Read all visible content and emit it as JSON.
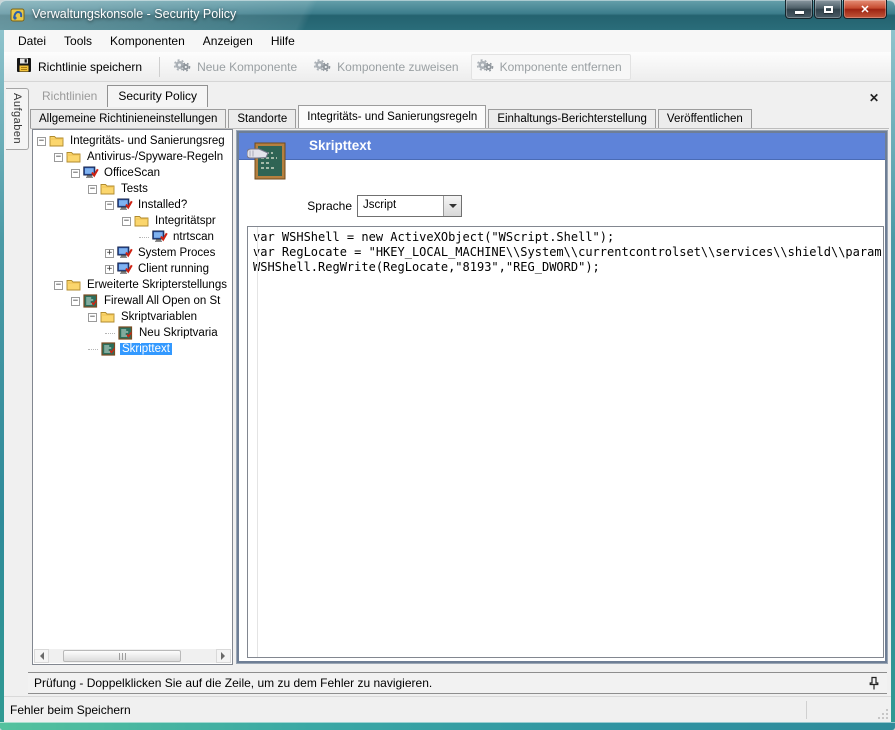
{
  "colors": {
    "titlebar_teal": "#24626f",
    "panel_header_blue": "#5e83d9",
    "tree_selection_blue": "#3399ff",
    "close_button_red": "#b03522"
  },
  "window": {
    "title": "Verwaltungskonsole - Security Policy",
    "controls": {
      "minimize": "minimize",
      "maximize": "maximize",
      "close": "close"
    }
  },
  "menu": {
    "items": [
      "Datei",
      "Tools",
      "Komponenten",
      "Anzeigen",
      "Hilfe"
    ]
  },
  "toolbar": {
    "save_label": "Richtlinie speichern",
    "new_component_label": "Neue Komponente",
    "assign_component_label": "Komponente zuweisen",
    "remove_component_label": "Komponente entfernen"
  },
  "side_tab": {
    "label": "Aufgaben"
  },
  "doc_tabs": [
    {
      "label": "Richtlinien",
      "active": false
    },
    {
      "label": "Security Policy",
      "active": true
    }
  ],
  "section_tabs": [
    {
      "label": "Allgemeine Richtinieneinstellungen",
      "active": false
    },
    {
      "label": "Standorte",
      "active": false
    },
    {
      "label": "Integritäts- und Sanierungsregeln",
      "active": true
    },
    {
      "label": "Einhaltungs-Berichterstellung",
      "active": false
    },
    {
      "label": "Veröffentlichen",
      "active": false
    }
  ],
  "tree": {
    "items": [
      {
        "label": "Integritäts- und Sanierungsreg",
        "level": 0,
        "expander": "-",
        "icon": "folder",
        "selected": false
      },
      {
        "label": "Antivirus-/Spyware-Regeln",
        "level": 1,
        "expander": "-",
        "icon": "folder",
        "selected": false
      },
      {
        "label": "OfficeScan",
        "level": 2,
        "expander": "-",
        "icon": "computer",
        "selected": false
      },
      {
        "label": "Tests",
        "level": 3,
        "expander": "-",
        "icon": "folder",
        "selected": false
      },
      {
        "label": "Installed?",
        "level": 4,
        "expander": "-",
        "icon": "computer",
        "selected": false
      },
      {
        "label": "Integritätspr",
        "level": 5,
        "expander": "-",
        "icon": "folder",
        "selected": false
      },
      {
        "label": "ntrtscan",
        "level": 6,
        "expander": null,
        "icon": "computer",
        "selected": false
      },
      {
        "label": "System Proces",
        "level": 4,
        "expander": "+",
        "icon": "computer",
        "selected": false
      },
      {
        "label": "Client running",
        "level": 4,
        "expander": "+",
        "icon": "computer",
        "selected": false
      },
      {
        "label": "Erweiterte Skripterstellungs",
        "level": 1,
        "expander": "-",
        "icon": "folder",
        "selected": false
      },
      {
        "label": "Firewall All Open on St",
        "level": 2,
        "expander": "-",
        "icon": "script",
        "selected": false
      },
      {
        "label": "Skriptvariablen",
        "level": 3,
        "expander": "-",
        "icon": "folder",
        "selected": false
      },
      {
        "label": "Neu Skriptvaria",
        "level": 4,
        "expander": null,
        "icon": "script",
        "selected": false
      },
      {
        "label": "Skripttext",
        "level": 3,
        "expander": null,
        "icon": "script",
        "selected": true
      }
    ]
  },
  "panel": {
    "title": "Skripttext",
    "language_label": "Sprache",
    "language_value": "Jscript",
    "code_lines": [
      "var WSHShell = new ActiveXObject(\"WScript.Shell\");",
      "var RegLocate = \"HKEY_LOCAL_MACHINE\\\\System\\\\currentcontrolset\\\\services\\\\shield\\\\param",
      "WSHShell.RegWrite(RegLocate,\"8193\",\"REG_DWORD\");"
    ]
  },
  "check_bar": {
    "text": "Prüfung - Doppelklicken Sie auf die Zeile, um zu dem Fehler zu navigieren."
  },
  "status_bar": {
    "text": "Fehler beim Speichern"
  }
}
